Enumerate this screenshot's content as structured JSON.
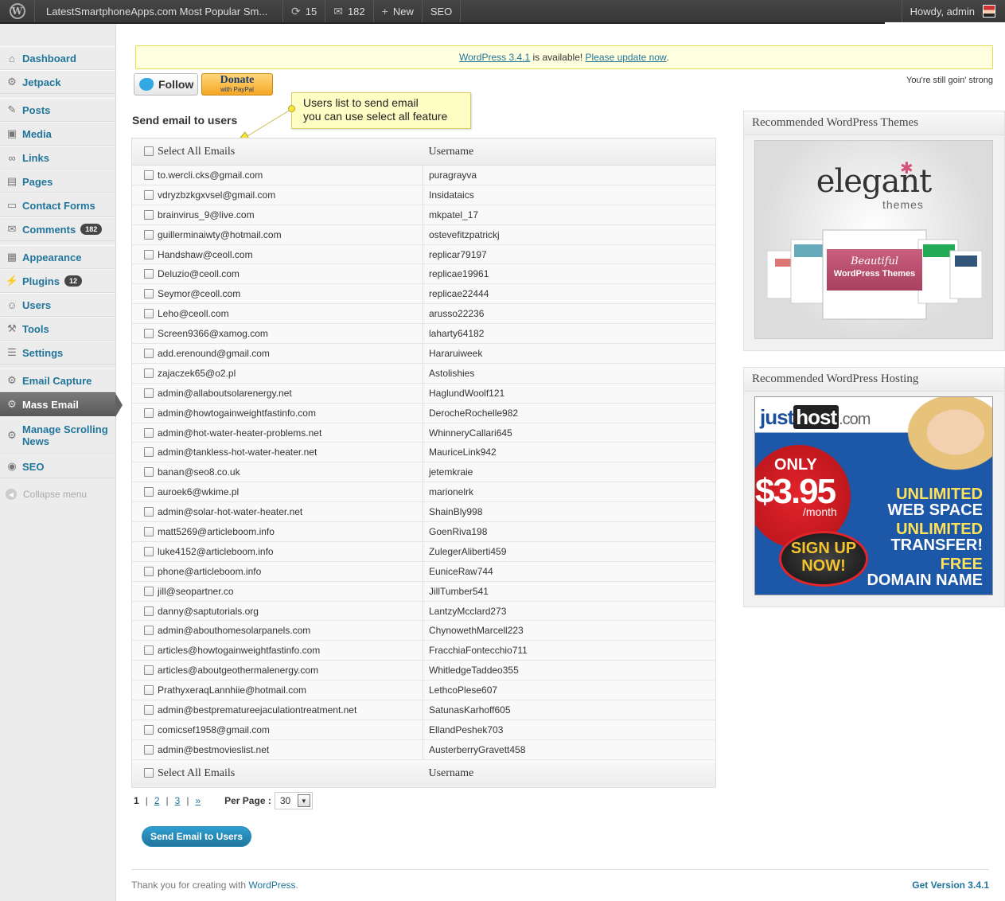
{
  "adminbar": {
    "site_title": "LatestSmartphoneApps.com Most Popular Sm...",
    "updates_count": "15",
    "comments_count": "182",
    "new_label": "New",
    "seo_label": "SEO",
    "howdy": "Howdy, admin"
  },
  "sidebar": {
    "items": [
      {
        "label": "Dashboard",
        "icon": "dashboard-icon",
        "glyph": "⌂"
      },
      {
        "label": "Jetpack",
        "icon": "jetpack-icon",
        "glyph": "⚙"
      },
      {
        "label": "Posts",
        "icon": "posts-icon",
        "glyph": "✎"
      },
      {
        "label": "Media",
        "icon": "media-icon",
        "glyph": "▣"
      },
      {
        "label": "Links",
        "icon": "links-icon",
        "glyph": "∞"
      },
      {
        "label": "Pages",
        "icon": "pages-icon",
        "glyph": "▤"
      },
      {
        "label": "Contact Forms",
        "icon": "contact-forms-icon",
        "glyph": "▭"
      },
      {
        "label": "Comments",
        "icon": "comments-icon",
        "glyph": "✉",
        "badge": "182"
      },
      {
        "label": "Appearance",
        "icon": "appearance-icon",
        "glyph": "▦"
      },
      {
        "label": "Plugins",
        "icon": "plugins-icon",
        "glyph": "⚡",
        "badge": "12"
      },
      {
        "label": "Users",
        "icon": "users-icon",
        "glyph": "☺"
      },
      {
        "label": "Tools",
        "icon": "tools-icon",
        "glyph": "⚒"
      },
      {
        "label": "Settings",
        "icon": "settings-icon",
        "glyph": "☰"
      },
      {
        "label": "Email Capture",
        "icon": "email-capture-icon",
        "glyph": "⚙"
      },
      {
        "label": "Mass Email",
        "icon": "mass-email-icon",
        "glyph": "⚙"
      },
      {
        "label": "Manage Scrolling News",
        "icon": "scrolling-news-icon",
        "glyph": "⚙"
      },
      {
        "label": "SEO",
        "icon": "seo-icon",
        "glyph": "◉"
      }
    ],
    "collapse_label": "Collapse menu"
  },
  "notice": {
    "version_link": "WordPress 3.4.1",
    "middle": " is available! ",
    "update_link": "Please update now",
    "end": "."
  },
  "tagline": "You're still goin' strong",
  "follow_label": "Follow",
  "donate_label": "Donate",
  "donate_sub": "with PayPal",
  "callout": {
    "line1": "Users list to send email",
    "line2": "you can use select all feature"
  },
  "section_title": "Send email to users",
  "table": {
    "col_email": "Select All Emails",
    "col_username": "Username",
    "rows": [
      {
        "email": "to.wercli.cks@gmail.com",
        "username": "puragrayva"
      },
      {
        "email": "vdryzbzkgxvsel@gmail.com",
        "username": "Insidataics"
      },
      {
        "email": "brainvirus_9@live.com",
        "username": "mkpatel_17"
      },
      {
        "email": "guillerminaiwty@hotmail.com",
        "username": "ostevefitzpatrickj"
      },
      {
        "email": "Handshaw@ceoll.com",
        "username": "replicar79197"
      },
      {
        "email": "Deluzio@ceoll.com",
        "username": "replicae19961"
      },
      {
        "email": "Seymor@ceoll.com",
        "username": "replicae22444"
      },
      {
        "email": "Leho@ceoll.com",
        "username": "arusso22236"
      },
      {
        "email": "Screen9366@xamog.com",
        "username": "laharty64182"
      },
      {
        "email": "add.erenound@gmail.com",
        "username": "Hararuiweek"
      },
      {
        "email": "zajaczek65@o2.pl",
        "username": "Astolishies"
      },
      {
        "email": "admin@allaboutsolarenergy.net",
        "username": "HaglundWoolf121"
      },
      {
        "email": "admin@howtogainweightfastinfo.com",
        "username": "DerocheRochelle982"
      },
      {
        "email": "admin@hot-water-heater-problems.net",
        "username": "WhinneryCallari645"
      },
      {
        "email": "admin@tankless-hot-water-heater.net",
        "username": "MauriceLink942"
      },
      {
        "email": "banan@seo8.co.uk",
        "username": "jetemkraie"
      },
      {
        "email": "auroek6@wkime.pl",
        "username": "marionelrk"
      },
      {
        "email": "admin@solar-hot-water-heater.net",
        "username": "ShainBly998"
      },
      {
        "email": "matt5269@articleboom.info",
        "username": "GoenRiva198"
      },
      {
        "email": "luke4152@articleboom.info",
        "username": "ZulegerAliberti459"
      },
      {
        "email": "phone@articleboom.info",
        "username": "EuniceRaw744"
      },
      {
        "email": "jill@seopartner.co",
        "username": "JillTumber541"
      },
      {
        "email": "danny@saptutorials.org",
        "username": "LantzyMcclard273"
      },
      {
        "email": "admin@abouthomesolarpanels.com",
        "username": "ChynowethMarcell223"
      },
      {
        "email": "articles@howtogainweightfastinfo.com",
        "username": "FracchiaFontecchio711"
      },
      {
        "email": "articles@aboutgeothermalenergy.com",
        "username": "WhitledgeTaddeo355"
      },
      {
        "email": "PrathyxeraqLannhiie@hotmail.com",
        "username": "LethcoPlese607"
      },
      {
        "email": "admin@bestprematureejaculationtreatment.net",
        "username": "SatunasKarhoff605"
      },
      {
        "email": "comicsef1958@gmail.com",
        "username": "EllandPeshek703"
      },
      {
        "email": "admin@bestmovieslist.net",
        "username": "AusterberryGravett458"
      }
    ]
  },
  "pagination": {
    "current": "1",
    "page2": "2",
    "page3": "3",
    "next": "»",
    "per_page_label": "Per Page :",
    "per_page_value": "30"
  },
  "send_button": "Send Email to Users",
  "footer": {
    "thanks": "Thank you for creating with ",
    "wp_link": "WordPress",
    "period": ".",
    "version": "Get Version 3.4.1"
  },
  "widgets": {
    "themes_title": "Recommended WordPress Themes",
    "hosting_title": "Recommended WordPress Hosting",
    "elegant_logo": "elegant",
    "elegant_sub": "themes",
    "elegant_ribbon1": "Beautiful",
    "elegant_ribbon2": "WordPress Themes",
    "jh_just": "just",
    "jh_host": "host",
    "jh_com": ".com",
    "jh_only": "ONLY",
    "jh_price": "$3.95",
    "jh_month": "/month",
    "jh_signup1": "SIGN UP",
    "jh_signup2": "NOW!",
    "jh_u1": "UNLIMITED",
    "jh_u1b": "WEB SPACE",
    "jh_u2": "UNLIMITED",
    "jh_u2b": "TRANSFER!",
    "jh_u3": "FREE",
    "jh_u3b": "DOMAIN NAME"
  }
}
